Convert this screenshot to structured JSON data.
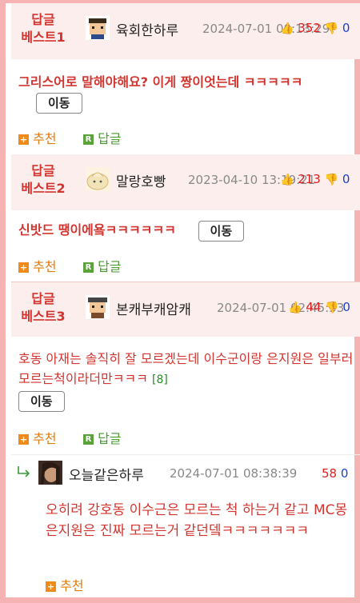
{
  "comments": [
    {
      "badge_line1": "답글",
      "badge_line2": "베스트1",
      "nickname": "육회한하루",
      "date": "2024-07-01 00:13:29",
      "upvotes": "352",
      "downvotes": "0",
      "text": "그리스어로 말해야해요? 이게 짱이엇는데 ㅋㅋㅋㅋㅋ",
      "move_label": "이동",
      "recommend_label": "추천",
      "reply_label": "답글"
    },
    {
      "badge_line1": "답글",
      "badge_line2": "베스트2",
      "nickname": "말랑호빵",
      "date": "2023-04-10 13:19:21",
      "upvotes": "213",
      "downvotes": "0",
      "text": "신밧드 땡이에욬ㅋㅋㅋㅋㅋㅋ",
      "move_label": "이동",
      "recommend_label": "추천",
      "reply_label": "답글"
    },
    {
      "badge_line1": "답글",
      "badge_line2": "베스트3",
      "nickname": "본캐부캐암캐",
      "date": "2024-07-01 02:45:53",
      "upvotes": "44",
      "downvotes": "0",
      "text": "호동 아재는 솔직히 잘 모르겠는데 이수군이랑 은지원은 일부러 모르는척이라더만ㅋㅋㅋ",
      "reply_count": "[8]",
      "move_label": "이동",
      "recommend_label": "추천",
      "reply_label": "답글"
    }
  ],
  "reply": {
    "nickname": "오늘같은하루",
    "date": "2024-07-01 08:38:39",
    "upvotes": "58",
    "downvotes": "0",
    "text": "오히려 강호동 이수근은 모르는 척 하는거 같고 MC몽 은지원은 진짜 모르는거 같던뎈ㅋㅋㅋㅋㅋㅋㅋ",
    "recommend_label": "추천"
  },
  "icons": {
    "thumbs_up": "thumbs-up-icon",
    "thumbs_down": "thumbs-down-icon",
    "plus": "plus-icon",
    "reply_r": "reply-r-icon",
    "reply_arrow": "reply-arrow-icon"
  },
  "colors": {
    "accent_red": "#d2352f",
    "header_bg": "#fdeeee",
    "border_pink": "#f6b3b3",
    "recommend_orange": "#e07d10",
    "reply_green": "#4a9a30",
    "down_blue": "#1a3fd0"
  }
}
